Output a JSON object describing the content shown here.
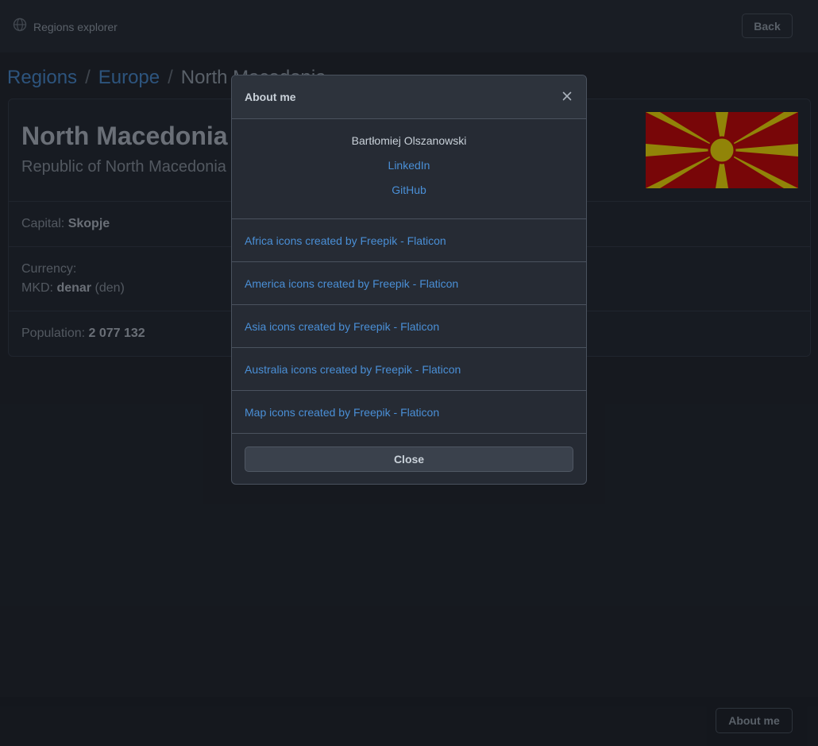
{
  "navbar": {
    "brand_icon": "globe-icon",
    "brand_label": "Regions explorer",
    "back_label": "Back"
  },
  "breadcrumb": {
    "items": [
      "Regions",
      "Europe",
      "North Macedonia"
    ],
    "separator": "/"
  },
  "country": {
    "name": "North Macedonia",
    "official_name": "Republic of North Macedonia",
    "capital_label": "Capital:",
    "capital": "Skopje",
    "currency_label": "Currency:",
    "currency_code": "MKD:",
    "currency_name": "denar",
    "currency_symbol": "(den)",
    "population_label": "Population:",
    "population": "2 077 132",
    "flag_colors": {
      "field": "#d20000",
      "sun": "#ffe600"
    }
  },
  "footer": {
    "about_label": "About me"
  },
  "modal": {
    "title": "About me",
    "close_icon": "close-icon",
    "author": "Bartłomiej Olszanowski",
    "links": [
      "LinkedIn",
      "GitHub"
    ],
    "credits": [
      "Africa icons created by Freepik - Flaticon",
      "America icons created by Freepik - Flaticon",
      "Asia icons created by Freepik - Flaticon",
      "Australia icons created by Freepik - Flaticon",
      "Map icons created by Freepik - Flaticon"
    ],
    "close_label": "Close"
  },
  "colors": {
    "background": "#1f232b",
    "link": "#4a8fd6",
    "modal_bg": "#262b34"
  }
}
